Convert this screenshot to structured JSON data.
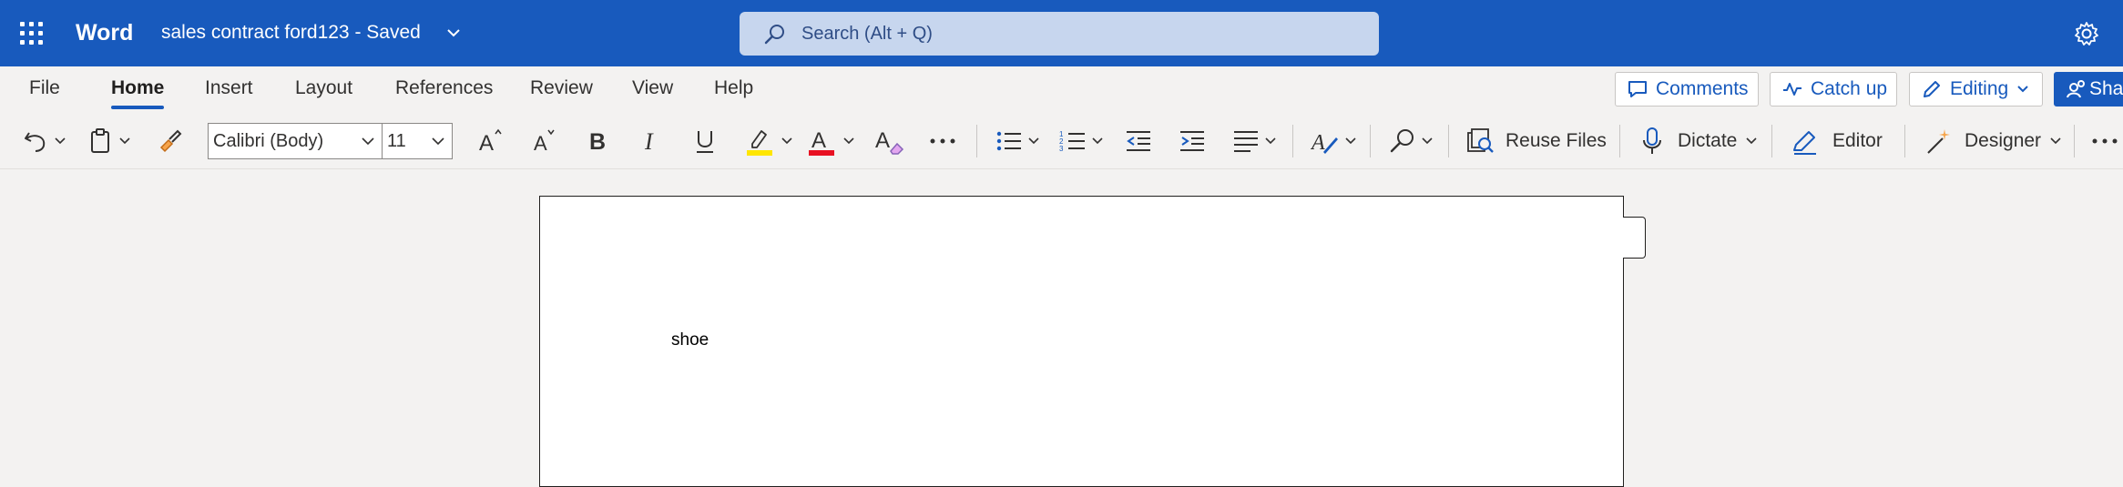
{
  "titlebar": {
    "app_name": "Word",
    "document_title": "sales contract ford123  -  Saved",
    "search_placeholder": "Search (Alt + Q)",
    "background_color": "#185abd"
  },
  "ribbon": {
    "tabs": [
      {
        "label": "File"
      },
      {
        "label": "Home",
        "active": true
      },
      {
        "label": "Insert"
      },
      {
        "label": "Layout"
      },
      {
        "label": "References"
      },
      {
        "label": "Review"
      },
      {
        "label": "View"
      },
      {
        "label": "Help"
      }
    ],
    "right_buttons": {
      "comments": "Comments",
      "catch_up": "Catch up",
      "editing": "Editing",
      "share": "Sha"
    }
  },
  "toolbar": {
    "font_name": "Calibri (Body)",
    "font_size": "11",
    "reuse_files": "Reuse Files",
    "dictate": "Dictate",
    "editor": "Editor",
    "designer": "Designer",
    "highlight_color": "#ffe600",
    "font_color": "#e81123"
  },
  "document": {
    "body_text": "shoe"
  }
}
